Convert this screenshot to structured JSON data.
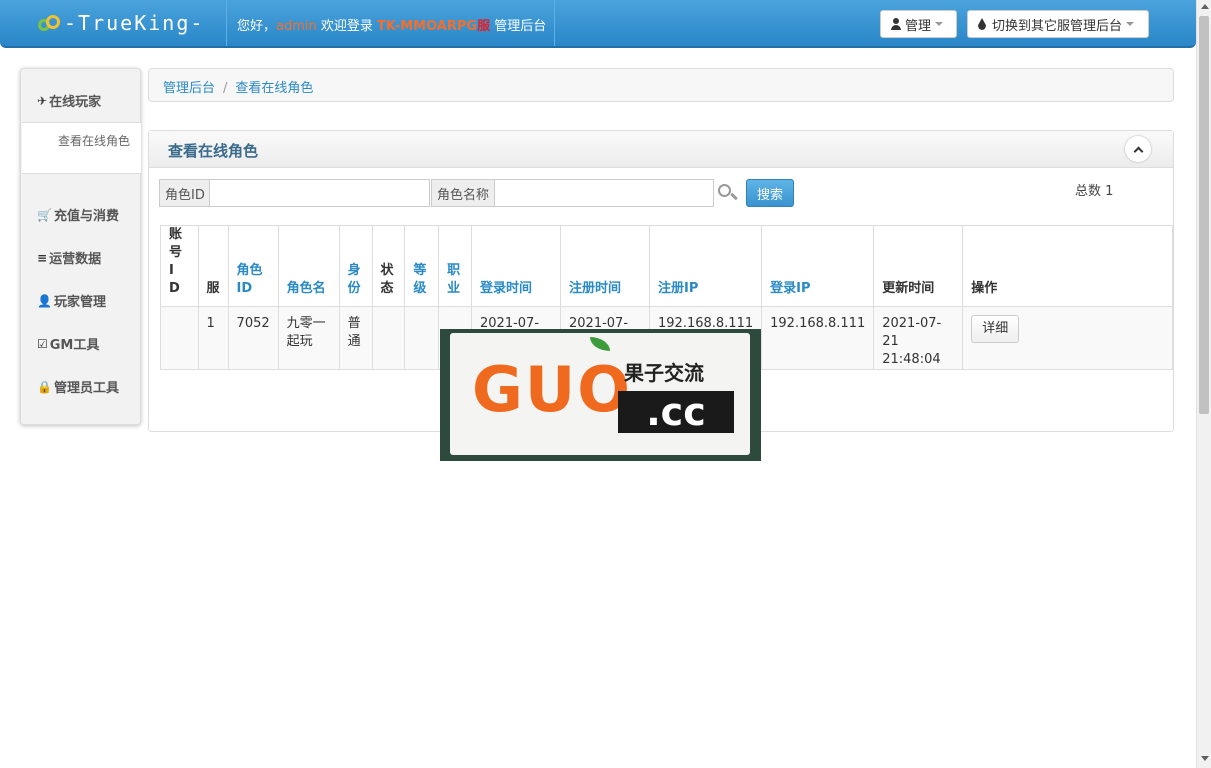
{
  "brand": {
    "text": "-TrueKing-"
  },
  "header": {
    "greeting": "您好，",
    "user": "admin",
    "welcome": " 欢迎登录 ",
    "game": "TK-MMOARPG",
    "server": "服",
    "suffix": " 管理后台",
    "admin_menu": "管理",
    "switch_menu": "切换到其它服管理后台"
  },
  "sidebar": {
    "items": [
      {
        "icon": "plane-icon",
        "glyph": "✈",
        "label": "在线玩家"
      },
      {
        "icon": "cart-icon",
        "glyph": "🛒",
        "label": "充值与消费"
      },
      {
        "icon": "list-icon",
        "glyph": "≡",
        "label": "运营数据"
      },
      {
        "icon": "user-icon",
        "glyph": "👤",
        "label": "玩家管理"
      },
      {
        "icon": "edit-icon",
        "glyph": "☑",
        "label": "GM工具"
      },
      {
        "icon": "lock-icon",
        "glyph": "🔒",
        "label": "管理员工具"
      }
    ],
    "sub_item": "查看在线角色"
  },
  "breadcrumb": {
    "home": "管理后台",
    "sep": "/",
    "current": "查看在线角色"
  },
  "panel": {
    "title": "查看在线角色",
    "filter_id_label": "角色ID",
    "filter_name_label": "角色名称",
    "search_label": "搜索",
    "total_label": "总数 1"
  },
  "table": {
    "headers": [
      "账号ID",
      "服",
      "角色ID",
      "角色名",
      "身份",
      "状态",
      "等级",
      "职业",
      "登录时间",
      "注册时间",
      "注册IP",
      "登录IP",
      "更新时间",
      "操作"
    ],
    "row": {
      "account_id": "",
      "server": "1",
      "role_id": "7052",
      "role_name": "九零一起玩",
      "identity": "普通",
      "status": "",
      "level": "",
      "job": "",
      "login_time": "2021-07-21 21:48:53",
      "register_time": "2021-07-21 21:47:34",
      "register_ip": "192.168.8.111",
      "login_ip": "192.168.8.111",
      "update_time": "2021-07-21 21:48:04",
      "action": "详细"
    }
  },
  "watermark": {
    "big": "GUO",
    "cc": ".cc",
    "cn": "果子交流"
  },
  "colors": {
    "navbar": "#2a86c8",
    "accent": "#f36f2b",
    "link": "#2a8ac5"
  }
}
